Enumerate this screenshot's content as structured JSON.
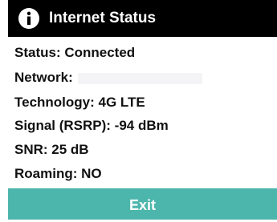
{
  "dialog": {
    "title": "Internet Status",
    "title_icon": "info-icon",
    "lines": {
      "status": "Status: Connected",
      "network": "Network:",
      "technology": "Technology: 4G LTE",
      "signal": "Signal (RSRP): -94 dBm",
      "snr": "SNR: 25 dB",
      "roaming": "Roaming: NO"
    },
    "exit_label": "Exit"
  },
  "colors": {
    "title_background": "#000000",
    "button_background": "#4db6ac",
    "text": "#111111"
  }
}
